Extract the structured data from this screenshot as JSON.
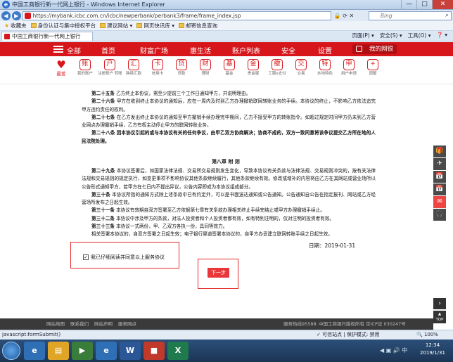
{
  "window": {
    "title": "中国工商银行新一代网上银行 - Windows Internet Explorer",
    "controls": [
      "—",
      "□",
      "✕"
    ]
  },
  "address": {
    "url": "https://mybank.icbc.com.cn/icbc/newperbank/perbank3/frame/frame_index.jsp",
    "lock": "🔒",
    "search_placeholder": "Bing"
  },
  "favorites": {
    "label": "收藏夹",
    "items": [
      "身份认证与集中授权平台",
      "建议网站 ▾",
      "网页快讯库 ▾",
      "邮寄信息查询"
    ]
  },
  "tab": {
    "title": "中国工商银行新一代网上银行",
    "tools": [
      "页面(P) ▾",
      "安全(S) ▾",
      "工具(O) ▾",
      "❓ ▾"
    ]
  },
  "nav": {
    "all": "全部",
    "items": [
      "首页",
      "财富广场",
      "惠生活",
      "账户列表",
      "安全",
      "设置"
    ],
    "mybank": "我的网银"
  },
  "icons": [
    {
      "glyph": "♥",
      "label": "最爱",
      "name": "favorite-icon"
    },
    {
      "glyph": "账",
      "label": "我的账户",
      "name": "my-account-icon"
    },
    {
      "glyph": "户",
      "label": "注册账户 转账",
      "name": "registered-account-icon"
    },
    {
      "glyph": "汇",
      "label": "跨境汇款",
      "name": "cross-border-remit-icon"
    },
    {
      "glyph": "卡",
      "label": "信用卡",
      "name": "credit-card-icon"
    },
    {
      "glyph": "贷",
      "label": "贷款",
      "name": "loan-icon"
    },
    {
      "glyph": "财",
      "label": "理财",
      "name": "wealth-icon"
    },
    {
      "glyph": "基",
      "label": "基金",
      "name": "fund-icon"
    },
    {
      "glyph": "金",
      "label": "贵金属",
      "name": "precious-metal-icon"
    },
    {
      "glyph": "缴",
      "label": "工银e支付",
      "name": "e-pay-icon"
    },
    {
      "glyph": "交",
      "label": "交易",
      "name": "trade-icon"
    },
    {
      "glyph": "特",
      "label": "本地特色",
      "name": "local-feature-icon"
    },
    {
      "glyph": "申",
      "label": "用户申请",
      "name": "user-apply-icon"
    },
    {
      "glyph": "+",
      "label": "调整",
      "name": "adjust-icon"
    }
  ],
  "terms_top": [
    {
      "num": "第二十五条",
      "text": "乙方终止本协议，需至少提前三个工作日通知甲方，并说明理由。"
    },
    {
      "num": "第二十六条",
      "text": "甲方在收到终止本协议的通知后，应在一周内及时到乙方办理撤销联网转账业务的手续。本协议的终止，不影响乙方依法追究甲方违约责任的权利。"
    },
    {
      "num": "第二十七条",
      "text": "在乙方发出终止本协议的通知至甲方撤销手续办理完毕期间，乙方不接受甲方的转账指令。如超过规定时间甲方仍未到乙方营业网点办理撤销手续，乙方有权主动停止甲方的联网转账业务。"
    },
    {
      "num": "第二十八条",
      "text": "因本协议引起的或与本协议有关的任何争议，由甲乙双方协商解决；协商不成的，双方一致同意将该争议提交乙方所在地的人民法院处理。"
    }
  ],
  "chapter_title": "第八章 附 则",
  "terms_bottom": [
    {
      "num": "第二十九条",
      "text": "本协议签署后，如国家法律法规、交易所交易规则发生变化，导致本协议有关条款与法律法规、交易规则冲突的，按有关法律法规和交易规则的规定执行，如变更事项不影响协议其他条款继续履行，其他条款继续有效。修改或增补的内容将由乙方在其网站或营业场所以公告形式通知甲方，若甲方在七日内不提出异议，公告内容即成为本协议组成部分。"
    },
    {
      "num": "第三十条",
      "text": "本协议所指的通知方式除上述条款中已有约定外，可以是书面送达通知或公告通知。公告通知自公告在指定报刊、网站或乙方经营场所发布之日起生效。"
    },
    {
      "num": "第三十一条",
      "text": "本协议有效期自双方签署至乙方依据第七章有关条款办理相关终止手续完结止或甲方办理撤销手续止。"
    },
    {
      "num": "第三十二条",
      "text": "本协议中涉及甲方的条款，对法人投资者和个人投资者都有效，如有特别注明的，仅对注明的投资者有效。"
    },
    {
      "num": "第三十三条",
      "text": "本协议一式两份，甲、乙双方各执一份，具同等效力。"
    },
    {
      "num": "",
      "text": "相关签署本协议的，自双方签署之日起生效；电子银行渠道签署本协议的，自甲方办妥建立联网转账手续之日起生效。"
    }
  ],
  "date": "日期：2019-01-31",
  "agree_label": "我已仔细阅读并同意以上服务协议",
  "next_button": "下一步",
  "float_bar": [
    "🎁",
    "✈",
    "📅",
    "📅",
    "✉",
    "🎧"
  ],
  "scroll_arrow": "›",
  "top_label": "TOP",
  "footer": {
    "links": [
      "网站地图",
      "联系我们",
      "网站声明",
      "服务网点"
    ],
    "hotline": "服务热线95588",
    "copyright": "中国工商银行版权所有",
    "icp": "京ICP证 030247号"
  },
  "status": {
    "left": "javascript:formSubmit()",
    "middle": "✓ 可信站点 | 保护模式: 禁用",
    "zoom": "🔍 100%"
  },
  "taskbar": {
    "time": "12:34",
    "date": "2019/1/31",
    "tray": "◀ ▣ 🔊 中"
  }
}
